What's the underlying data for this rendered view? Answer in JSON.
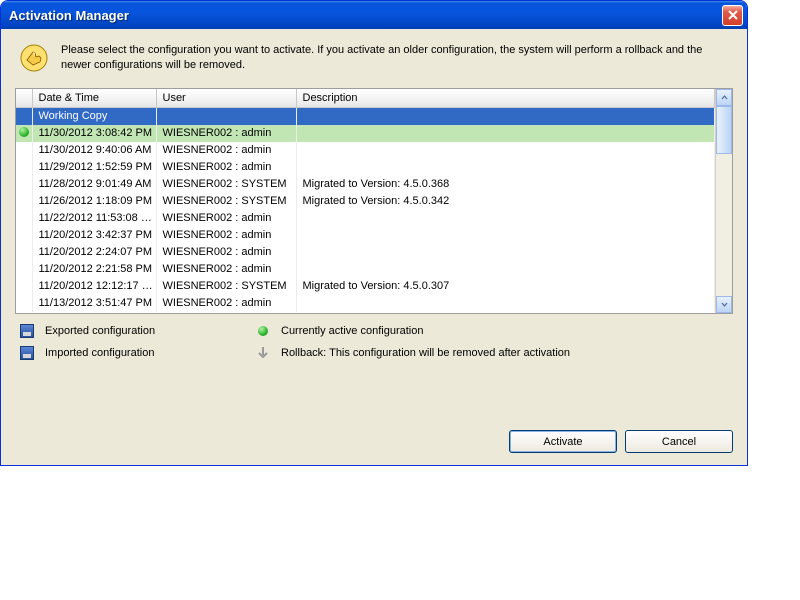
{
  "window": {
    "title": "Activation Manager"
  },
  "info": {
    "text": "Please select the configuration you want to activate. If you activate an older configuration, the system will perform a rollback and the newer configurations will be removed."
  },
  "table": {
    "headers": {
      "datetime": "Date & Time",
      "user": "User",
      "description": "Description"
    },
    "rows": [
      {
        "status": "",
        "datetime": "Working Copy",
        "user": "",
        "description": "",
        "state": "selected"
      },
      {
        "status": "active",
        "datetime": "11/30/2012 3:08:42 PM",
        "user": "WIESNER002 : admin",
        "description": "",
        "state": "active"
      },
      {
        "status": "",
        "datetime": "11/30/2012 9:40:06 AM",
        "user": "WIESNER002 : admin",
        "description": ""
      },
      {
        "status": "",
        "datetime": "11/29/2012 1:52:59 PM",
        "user": "WIESNER002 : admin",
        "description": ""
      },
      {
        "status": "",
        "datetime": "11/28/2012 9:01:49 AM",
        "user": "WIESNER002 : SYSTEM",
        "description": "Migrated to Version: 4.5.0.368"
      },
      {
        "status": "",
        "datetime": "11/26/2012 1:18:09 PM",
        "user": "WIESNER002 : SYSTEM",
        "description": "Migrated to Version: 4.5.0.342"
      },
      {
        "status": "",
        "datetime": "11/22/2012 11:53:08 …",
        "user": "WIESNER002 : admin",
        "description": ""
      },
      {
        "status": "",
        "datetime": "11/20/2012 3:42:37 PM",
        "user": "WIESNER002 : admin",
        "description": ""
      },
      {
        "status": "",
        "datetime": "11/20/2012 2:24:07 PM",
        "user": "WIESNER002 : admin",
        "description": ""
      },
      {
        "status": "",
        "datetime": "11/20/2012 2:21:58 PM",
        "user": "WIESNER002 : admin",
        "description": ""
      },
      {
        "status": "",
        "datetime": "11/20/2012 12:12:17 …",
        "user": "WIESNER002 : SYSTEM",
        "description": "Migrated to Version: 4.5.0.307"
      },
      {
        "status": "",
        "datetime": "11/13/2012 3:51:47 PM",
        "user": "WIESNER002 : admin",
        "description": ""
      }
    ]
  },
  "legend": {
    "exported": "Exported configuration",
    "active": "Currently active configuration",
    "imported": "Imported configuration",
    "rollback": "Rollback: This configuration will be removed after activation"
  },
  "buttons": {
    "activate": "Activate",
    "cancel": "Cancel"
  }
}
